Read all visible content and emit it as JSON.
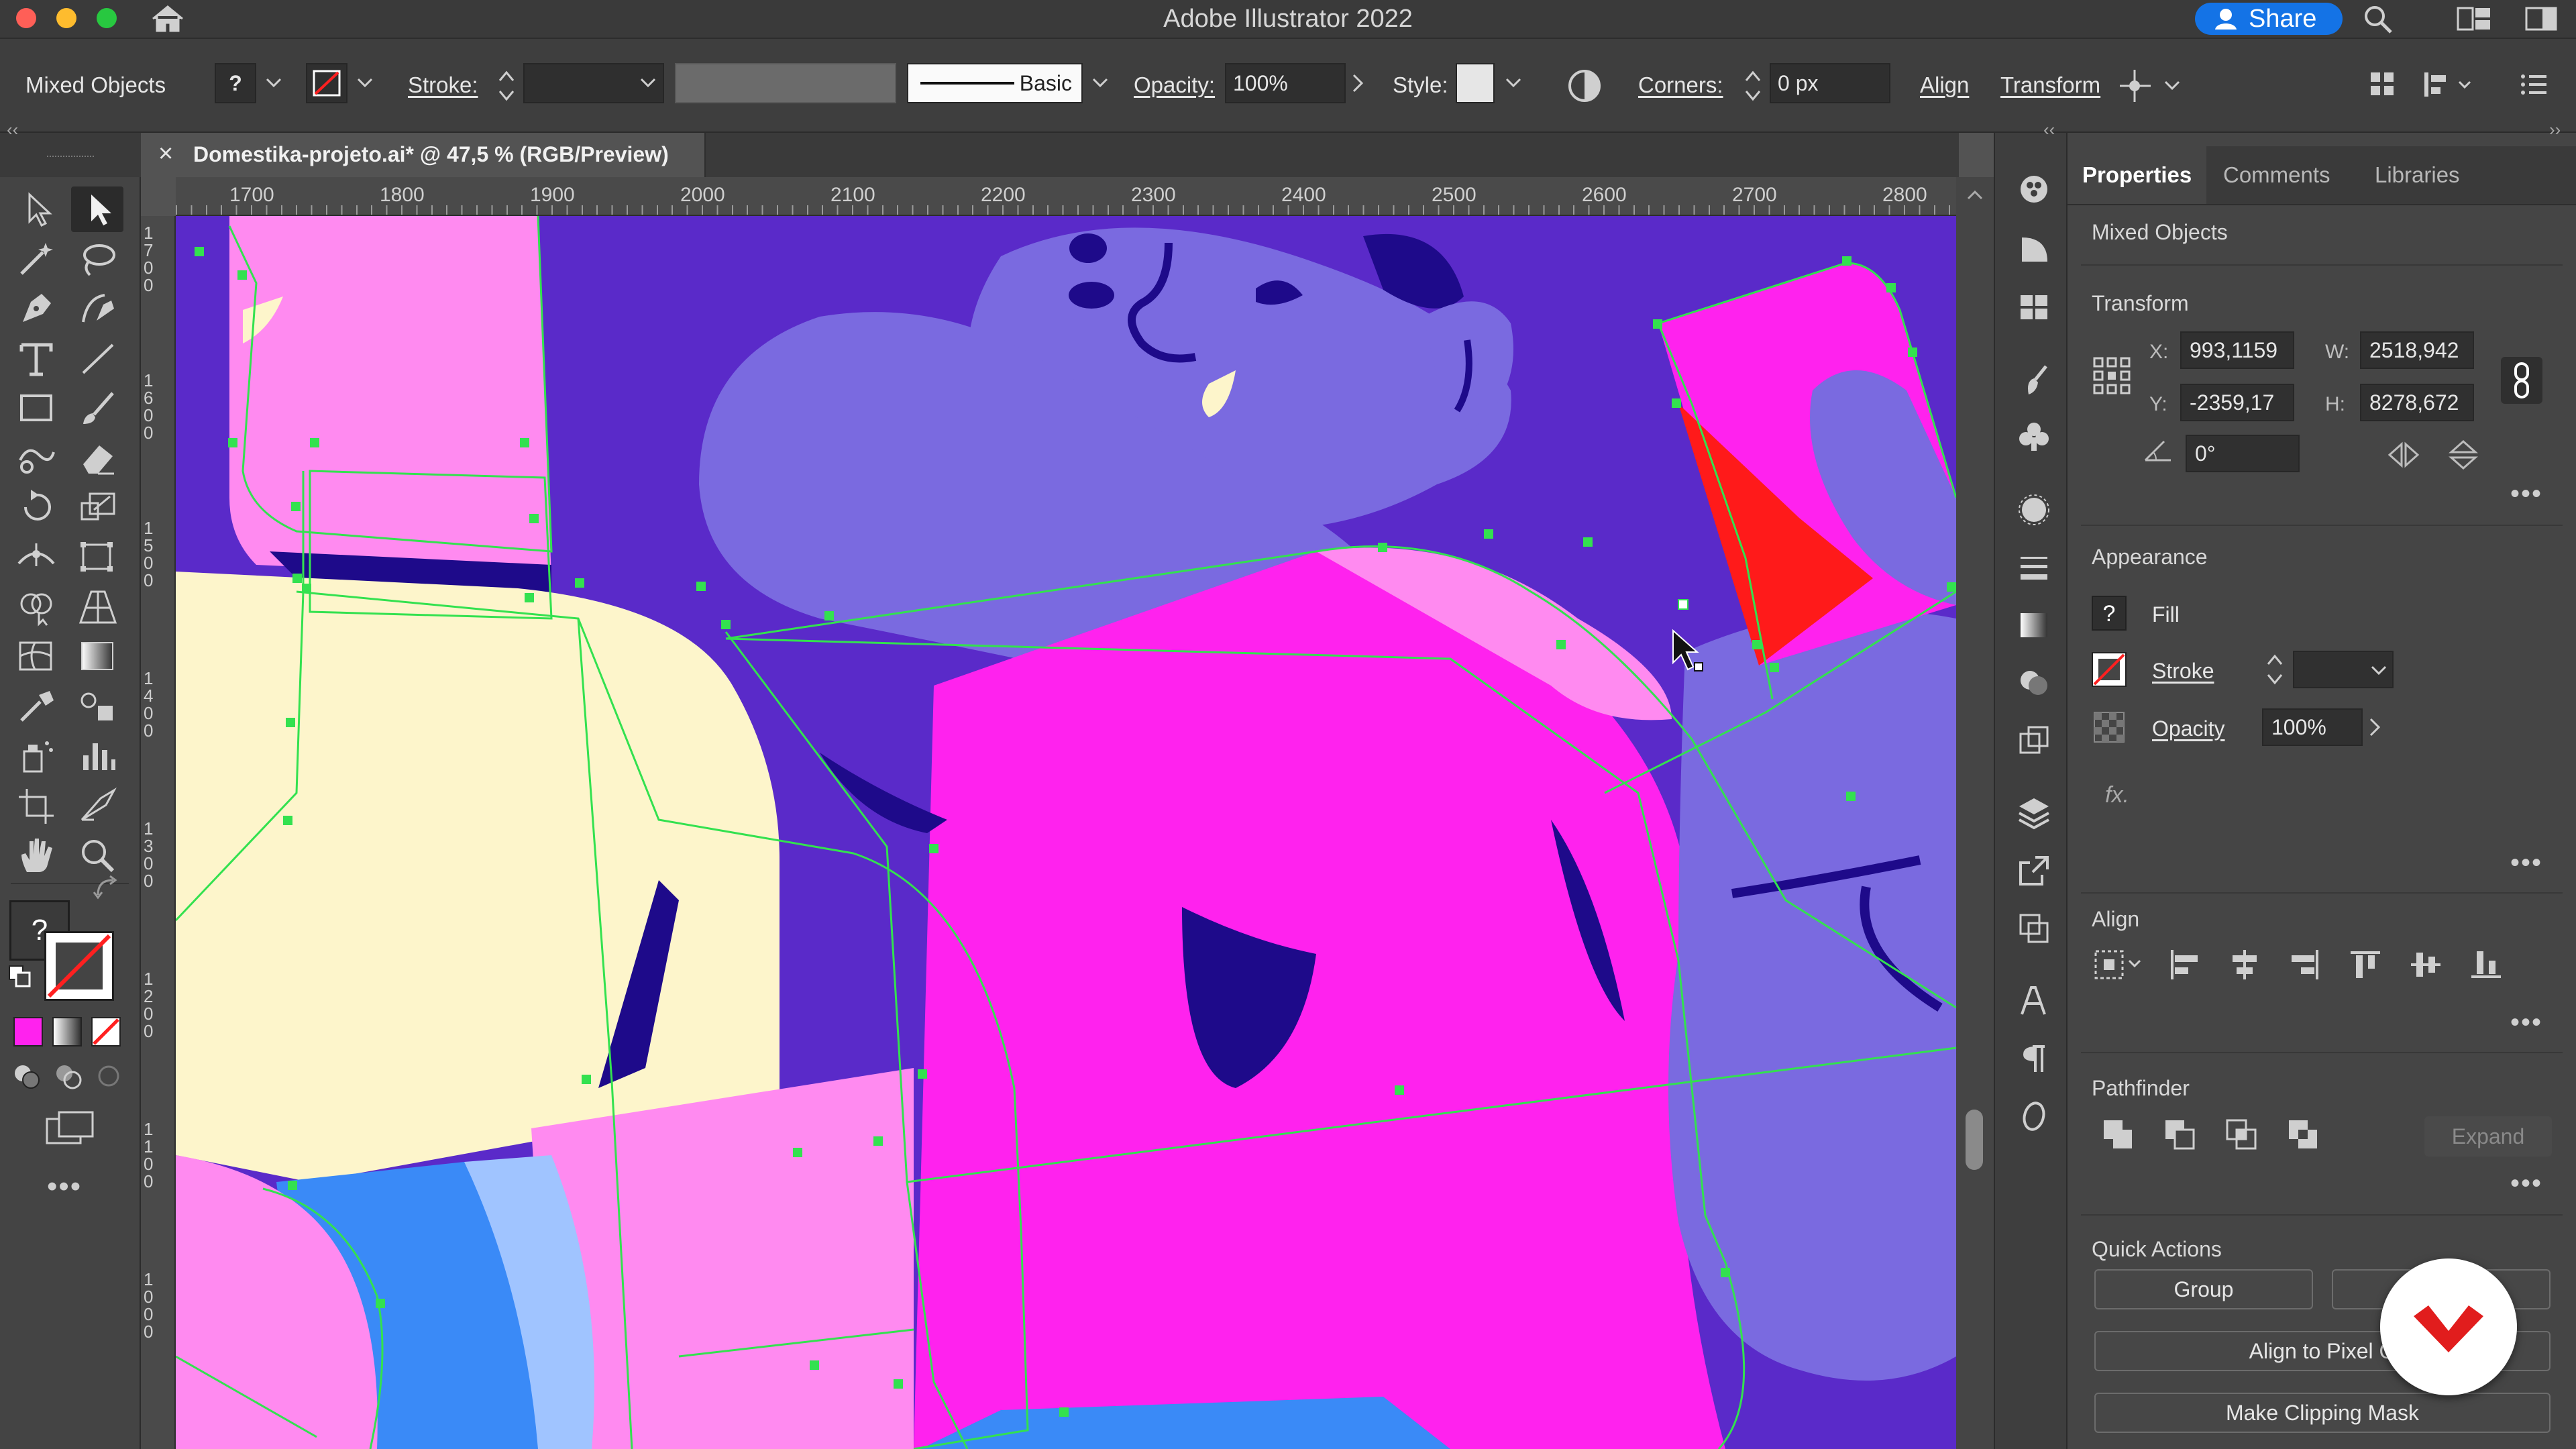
{
  "app": {
    "title": "Adobe Illustrator 2022",
    "share_label": "Share"
  },
  "control_bar": {
    "selection_type": "Mixed Objects",
    "stroke_label": "Stroke:",
    "brush_label": "Basic",
    "opacity_label": "Opacity:",
    "opacity_value": "100%",
    "style_label": "Style:",
    "corners_label": "Corners:",
    "corners_value": "0 px",
    "align_label": "Align",
    "transform_label": "Transform"
  },
  "document_tab": {
    "title": "Domestika-projeto.ai* @ 47,5 % (RGB/Preview)"
  },
  "ruler": {
    "top_ticks": [
      "1700",
      "1800",
      "1900",
      "2000",
      "2100",
      "2200",
      "2300",
      "2400",
      "2500",
      "2600",
      "2700",
      "2800"
    ],
    "left_ticks": [
      "1700",
      "1600",
      "1500",
      "1400",
      "1300",
      "1200",
      "1100",
      "1000"
    ]
  },
  "panel": {
    "tabs": [
      "Properties",
      "Comments",
      "Libraries"
    ],
    "active_tab": "Properties",
    "selection_type": "Mixed Objects",
    "transform": {
      "title": "Transform",
      "x_label": "X:",
      "x_value": "993,1159",
      "y_label": "Y:",
      "y_value": "-2359,17",
      "w_label": "W:",
      "w_value": "2518,942",
      "h_label": "H:",
      "h_value": "8278,672",
      "angle_value": "0°"
    },
    "appearance": {
      "title": "Appearance",
      "fill_label": "Fill",
      "stroke_label": "Stroke",
      "opacity_label": "Opacity",
      "opacity_value": "100%",
      "fx_label": "fx."
    },
    "align": {
      "title": "Align"
    },
    "pathfinder": {
      "title": "Pathfinder",
      "expand_label": "Expand"
    },
    "quick_actions": {
      "title": "Quick Actions",
      "group_label": "Group",
      "align_pixel_label": "Align to Pixel G",
      "clipping_mask_label": "Make Clipping Mask"
    }
  },
  "colors": {
    "purple_bg": "#5a2ac9",
    "lavender": "#7a6ae0",
    "navy": "#1e0a8a",
    "magenta": "#ff22ee",
    "pink": "#ff8af0",
    "cream": "#fdf5cb",
    "blue": "#3a8af7",
    "light_blue": "#a0c4ff",
    "red": "#ff1a1a",
    "selection_green": "#33e14f",
    "accent_blue": "#1473e6"
  }
}
